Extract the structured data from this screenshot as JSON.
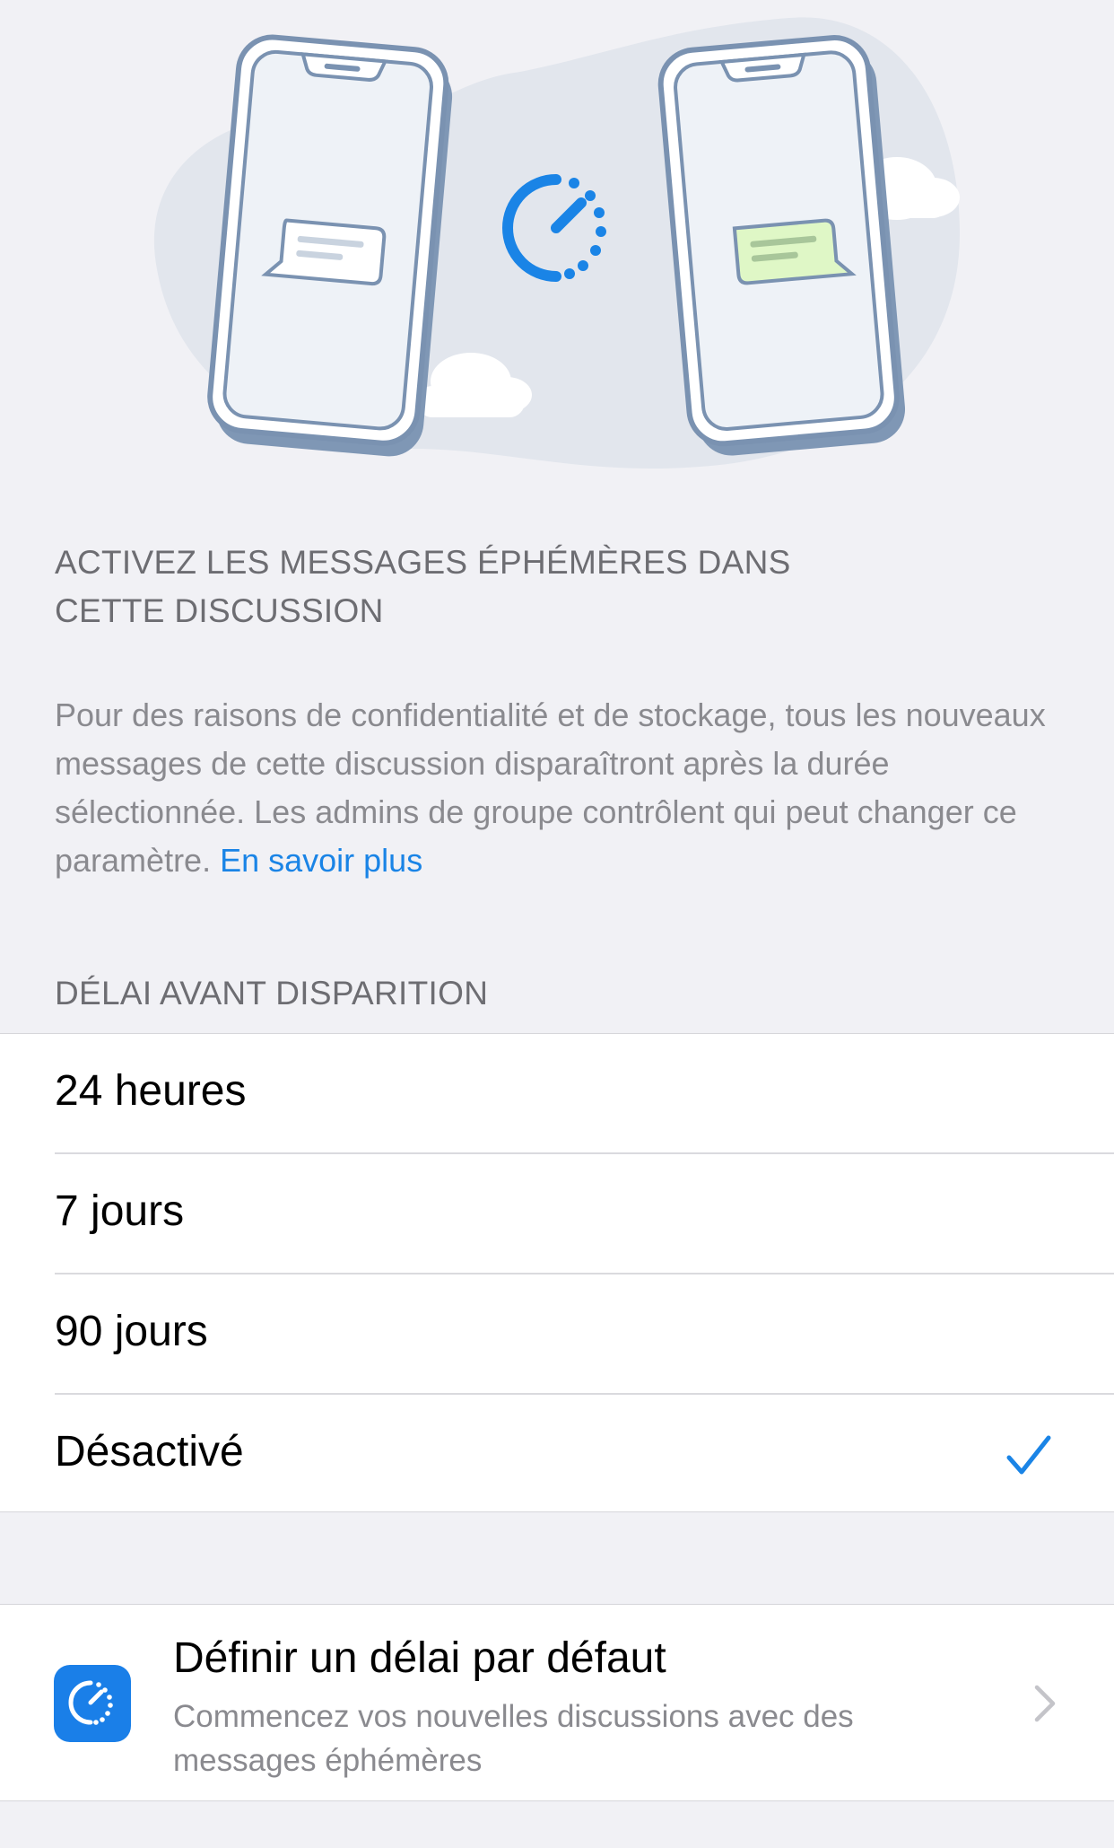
{
  "header": {
    "activate_title": "ACTIVEZ LES MESSAGES ÉPHÉMÈRES DANS CETTE DISCUSSION"
  },
  "description": {
    "text": "Pour des raisons de confidentialité et de stockage, tous les nouveaux messages de cette discussion disparaîtront après la durée sélectionnée. Les admins de groupe contrôlent qui peut changer ce paramètre.",
    "link": "En savoir plus"
  },
  "delay_section": {
    "title": "DÉLAI AVANT DISPARITION",
    "options": [
      {
        "label": "24 heures",
        "selected": false
      },
      {
        "label": "7 jours",
        "selected": false
      },
      {
        "label": "90 jours",
        "selected": false
      },
      {
        "label": "Désactivé",
        "selected": true
      }
    ]
  },
  "default_timer": {
    "title": "Définir un délai par défaut",
    "subtitle": "Commencez vos nouvelles discussions avec des messages éphémères",
    "icon": "timer-icon"
  },
  "colors": {
    "accent": "#1a84e6",
    "background": "#f1f1f5",
    "secondary_text": "#8a8a8f",
    "sent_bubble": "#dff7c6"
  },
  "icons": {
    "illustration": "two-phones-with-timer-illustration",
    "check": "checkmark-icon",
    "chevron": "chevron-right-icon"
  }
}
